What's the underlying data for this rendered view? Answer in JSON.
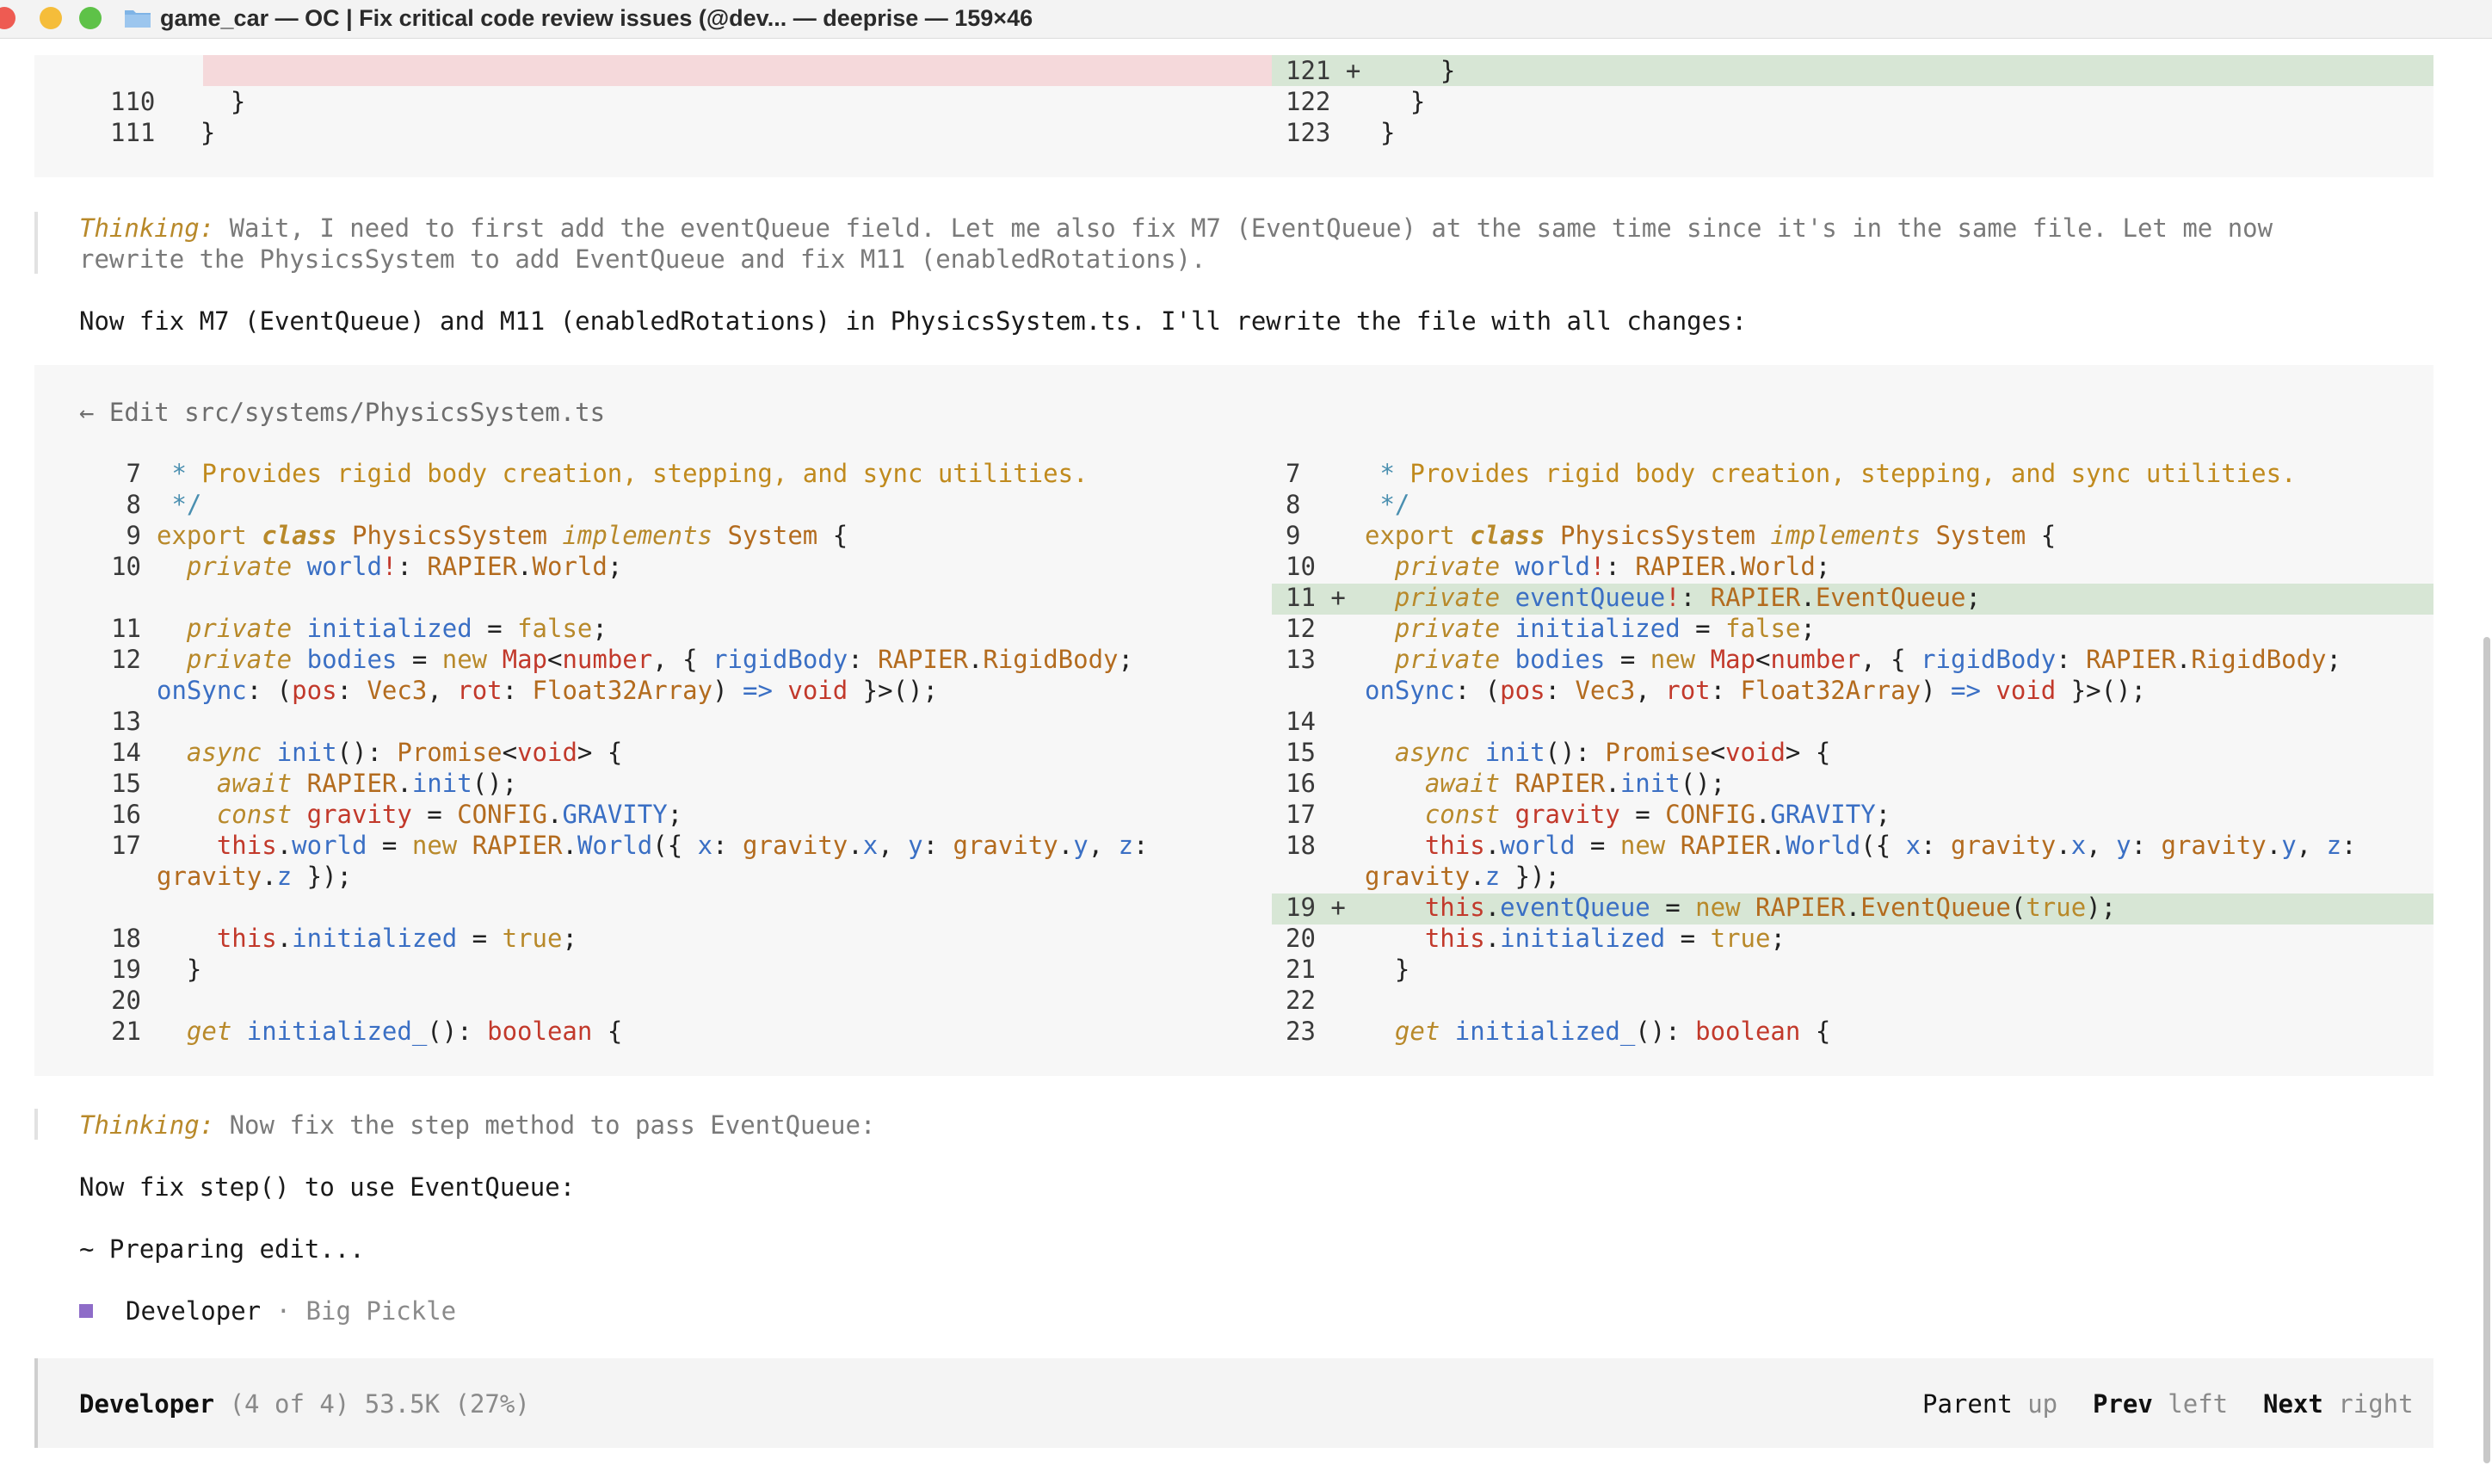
{
  "window": {
    "title": "game_car — OC | Fix critical code review issues (@dev... — deeprise — 159×46"
  },
  "top_diff": {
    "left": [
      {
        "num": "110",
        "code": "    }"
      },
      {
        "num": "111",
        "code": "  }"
      }
    ],
    "right": [
      {
        "num": "121 +",
        "code": "    }"
      },
      {
        "num": "122",
        "code": "  }"
      },
      {
        "num": "123",
        "code": "}"
      }
    ]
  },
  "thinking1": {
    "label": "Thinking:",
    "line1": " Wait, I need to first add the eventQueue field. Let me also fix M7 (EventQueue) at the same time since it's in the same file. Let me now",
    "line2": "rewrite the PhysicsSystem to add EventQueue and fix M11 (enabledRotations)."
  },
  "message1": "Now fix M7 (EventQueue) and M11 (enabledRotations) in PhysicsSystem.ts. I'll rewrite the file with all changes:",
  "edit": {
    "header": "← Edit src/systems/PhysicsSystem.ts",
    "left_nums": [
      "7",
      "8",
      "9",
      "10",
      "11",
      "12",
      "13",
      "14",
      "15",
      "16",
      "17",
      "18",
      "19",
      "20",
      "21"
    ],
    "right_nums": [
      "7",
      "8",
      "9",
      "10",
      "11 +",
      "12",
      "13",
      "14",
      "15",
      "16",
      "17",
      "18",
      "19 +",
      "20",
      "21",
      "22",
      "23"
    ]
  },
  "thinking2": {
    "label": "Thinking:",
    "text": " Now fix the step method to pass EventQueue:"
  },
  "message2": "Now fix step() to use EventQueue:",
  "preparing": "~ Preparing edit...",
  "agent": {
    "name": "Developer",
    "model": " · Big Pickle"
  },
  "status": {
    "agent": "Developer",
    "info": " (4 of 4) 53.5K (27%)",
    "nav": [
      {
        "label": "Parent",
        "key": " up"
      },
      {
        "label": "Prev",
        "key": " left"
      },
      {
        "label": "Next",
        "key": " right"
      }
    ]
  },
  "colors": {
    "removed_bg": "#f5d9db",
    "added_bg": "#d7e6d5",
    "accent_purple": "#8e6cc8"
  }
}
